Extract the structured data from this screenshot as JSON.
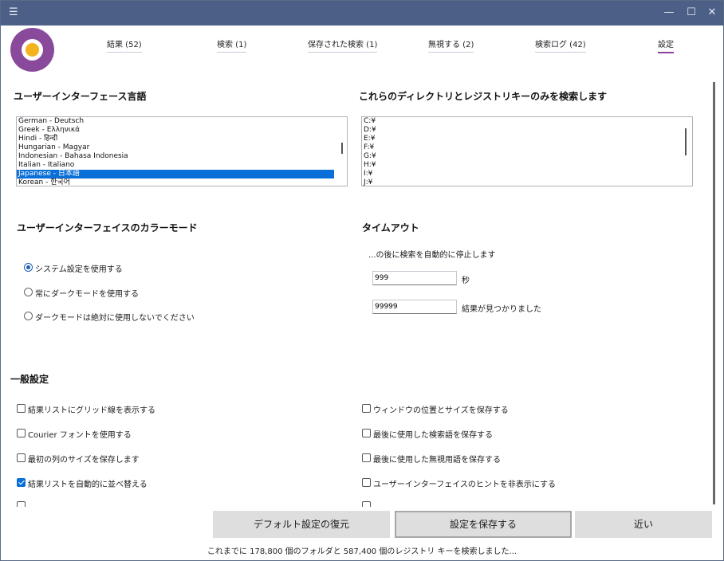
{
  "titlebar": {
    "menu_icon": "hamburger-menu-icon",
    "controls": [
      "minimize-icon",
      "maximize-icon",
      "close-icon"
    ]
  },
  "tabs": [
    {
      "label": "結果 (52)"
    },
    {
      "label": "検索 (1)"
    },
    {
      "label": "保存された検索 (1)"
    },
    {
      "label": "無視する (2)"
    },
    {
      "label": "検索ログ (42)"
    },
    {
      "label": "設定"
    }
  ],
  "language": {
    "title": "ユーザーインターフェース言語",
    "items": [
      "German - Deutsch",
      "Greek - Ελληνικά",
      "Hindi - हिन्दी",
      "Hungarian - Magyar",
      "Indonesian - Bahasa Indonesia",
      "Italian - Italiano",
      "Japanese - 日本語",
      "Korean - 한국어"
    ],
    "selected": "Japanese - 日本語"
  },
  "directories": {
    "title": "これらのディレクトリとレジストリキーのみを検索します",
    "items": [
      "C:¥",
      "D:¥",
      "E:¥",
      "F:¥",
      "G:¥",
      "H:¥",
      "I:¥",
      "J:¥"
    ]
  },
  "color_mode": {
    "title": "ユーザーインターフェイスのカラーモード",
    "options": [
      "システム設定を使用する",
      "常にダークモードを使用する",
      "ダークモードは絶対に使用しないでください"
    ],
    "selected_index": 0
  },
  "timeout": {
    "title": "タイムアウト",
    "description": "...の後に検索を自動的に停止します",
    "seconds_value": "999",
    "seconds_unit": "秒",
    "results_value": "99999",
    "results_unit": "結果が見つかりました"
  },
  "general": {
    "title": "一般設定",
    "left": [
      {
        "label": "結果リストにグリッド線を表示する",
        "checked": false
      },
      {
        "label": "Courier フォントを使用する",
        "checked": false
      },
      {
        "label": "最初の列のサイズを保存します",
        "checked": false
      },
      {
        "label": "結果リストを自動的に並べ替える",
        "checked": true
      }
    ],
    "right": [
      {
        "label": "ウィンドウの位置とサイズを保存する",
        "checked": false
      },
      {
        "label": "最後に使用した検索語を保存する",
        "checked": false
      },
      {
        "label": "最後に使用した無視用語を保存する",
        "checked": false
      },
      {
        "label": "ユーザーインターフェイスのヒントを非表示にする",
        "checked": false
      }
    ]
  },
  "buttons": {
    "restore": "デフォルト設定の復元",
    "save": "設定を保存する",
    "close": "近い"
  },
  "status": "これまでに 178,800 個のフォルダと 587,400 個のレジストリ キーを検索しました..."
}
